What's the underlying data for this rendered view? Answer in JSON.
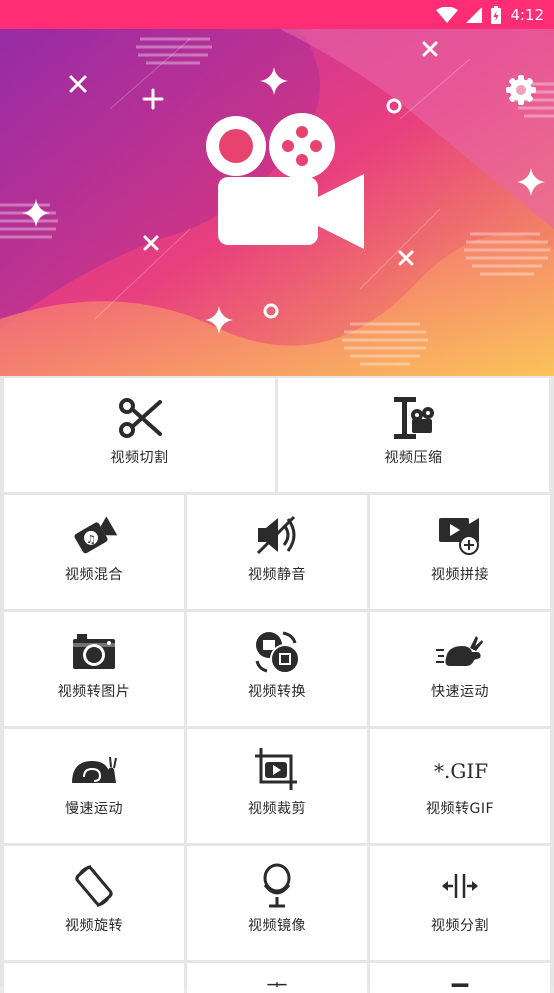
{
  "status": {
    "time": "4:12"
  },
  "colors": {
    "statusbar": "#ff2d73",
    "icon": "#2b2b2b"
  },
  "tools": [
    {
      "label": "视频切割",
      "icon": "scissors-icon"
    },
    {
      "label": "视频压缩",
      "icon": "compress-icon"
    },
    {
      "label": "视频混合",
      "icon": "music-camera-icon"
    },
    {
      "label": "视频静音",
      "icon": "mute-icon"
    },
    {
      "label": "视频拼接",
      "icon": "video-add-icon"
    },
    {
      "label": "视频转图片",
      "icon": "camera-icon"
    },
    {
      "label": "视频转换",
      "icon": "convert-icon"
    },
    {
      "label": "快速运动",
      "icon": "rabbit-icon"
    },
    {
      "label": "慢速运动",
      "icon": "snail-icon"
    },
    {
      "label": "视频裁剪",
      "icon": "crop-icon"
    },
    {
      "label": "视频转GIF",
      "icon": "gif-icon"
    },
    {
      "label": "视频旋转",
      "icon": "rotate-icon"
    },
    {
      "label": "视频镜像",
      "icon": "mirror-icon"
    },
    {
      "label": "视频分割",
      "icon": "split-icon"
    }
  ],
  "gif_text": "*.GIF"
}
